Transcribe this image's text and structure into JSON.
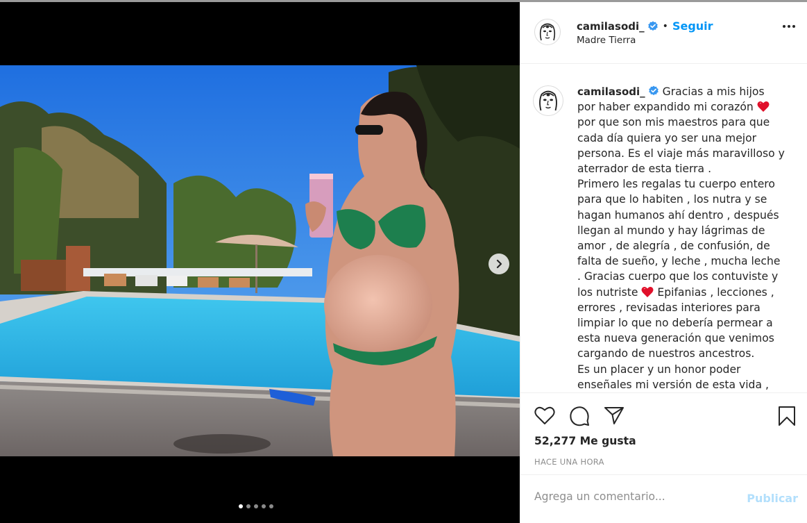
{
  "post": {
    "username": "camilasodi_",
    "follow_separator": "•",
    "follow_label": "Seguir",
    "location": "Madre Tierra",
    "caption_username": "camilasodi_",
    "caption_part1": "Gracias a mis hijos por haber expandido mi corazón",
    "caption_part2": "por que son mis maestros para que cada día quiera yo ser una mejor persona. Es el viaje más maravilloso y aterrador de esta tierra .",
    "caption_part3": "Primero les regalas tu cuerpo entero para que lo habiten , los nutra y se hagan humanos ahí dentro , después llegan al mundo y hay lágrimas de amor , de alegría , de confusión, de falta de sueño, y leche , mucha leche . Gracias cuerpo que los contuviste y los nutriste",
    "caption_part4": "Epifanias , lecciones , errores , revisadas interiores para limpiar lo que no debería permear a esta nueva generación que venimos cargando de nuestros ancestros.",
    "caption_part5": "Es un placer y un honor poder enseñales mi versión de esta vida ,",
    "likes": "52,277 Me gusta",
    "time": "HACE UNA HORA",
    "comment_placeholder": "Agrega un comentario...",
    "publish_label": "Publicar"
  },
  "carousel": {
    "slide_count": 5,
    "current_slide": 1
  },
  "icons": {
    "verified": "verified-badge-icon",
    "heart_emoji": "red-heart-emoji",
    "like": "heart-outline-icon",
    "comment": "comment-bubble-icon",
    "share": "paper-plane-icon",
    "save": "bookmark-icon",
    "more": "more-options-icon",
    "next": "chevron-right-icon"
  },
  "colors": {
    "accent": "#0095f6",
    "publish_disabled": "#b2dffc",
    "verified": "#3897f0",
    "heart": "#e0102a",
    "text": "#262626",
    "muted": "#8e8e8e"
  }
}
